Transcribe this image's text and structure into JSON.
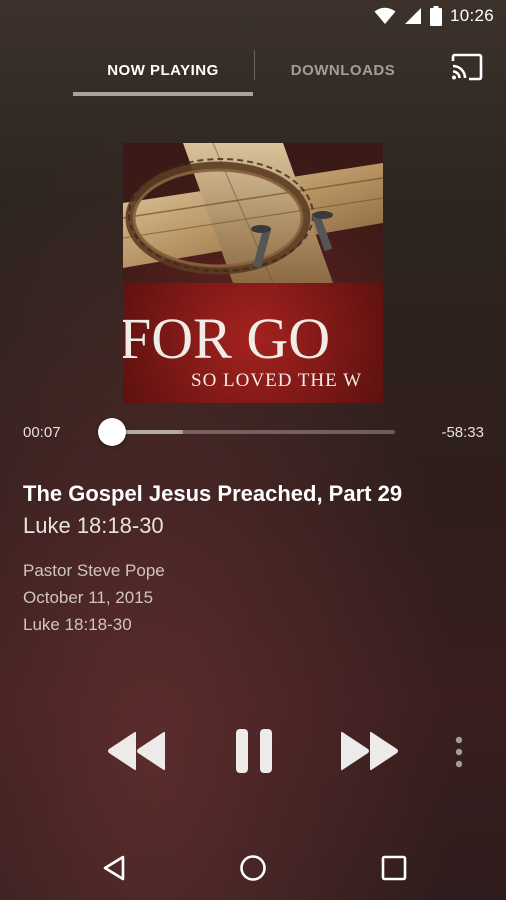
{
  "status_bar": {
    "time": "10:26",
    "icons": [
      "wifi-icon",
      "signal-icon",
      "battery-icon"
    ]
  },
  "tabs": [
    {
      "label": "NOW PLAYING",
      "active": true
    },
    {
      "label": "DOWNLOADS",
      "active": false
    }
  ],
  "cast": {
    "icon": "cast-icon"
  },
  "album_art": {
    "line1": "FOR GO",
    "line2": "SO LOVED THE W"
  },
  "player": {
    "elapsed": "00:07",
    "remaining": "-58:33",
    "progress": 0.002,
    "buffered": 0.25
  },
  "track": {
    "title": "The Gospel Jesus Preached, Part 29",
    "subtitle": "Luke 18:18-30",
    "speaker": "Pastor Steve Pope",
    "date": "October 11, 2015",
    "reference": "Luke 18:18-30"
  },
  "controls": [
    "rewind-icon",
    "pause-icon",
    "fast-forward-icon",
    "more-vert-icon"
  ],
  "nav": [
    "back-icon",
    "home-icon",
    "recents-icon"
  ],
  "colors": {
    "tab_indicator": "#a9a39d",
    "text_primary": "#ffffff",
    "text_secondary": "#cfc6c1"
  }
}
